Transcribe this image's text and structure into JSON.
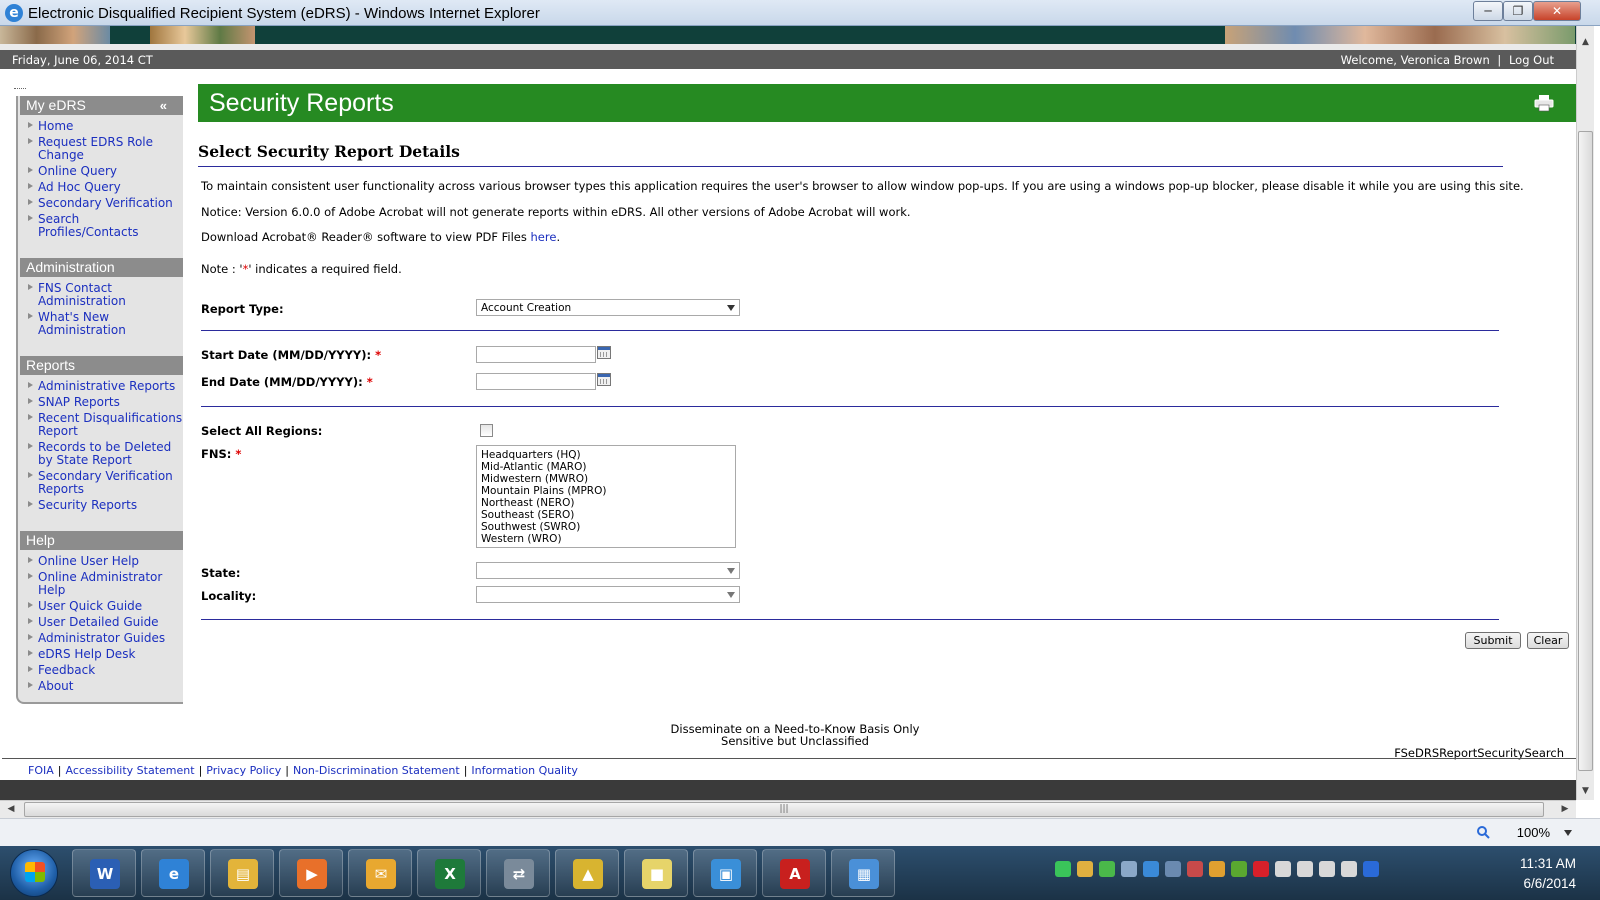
{
  "window": {
    "title": "Electronic Disqualified Recipient System (eDRS) - Windows Internet Explorer",
    "min_label": "─",
    "max_label": "❐",
    "close_label": "✕"
  },
  "status_bar": {
    "date": "Friday, June 06, 2014 CT",
    "welcome": "Welcome, Veronica Brown",
    "separator": "|",
    "logout": "Log Out"
  },
  "sidebar": {
    "collapse": "«",
    "sections": [
      {
        "title": "My eDRS",
        "items": [
          "Home",
          "Request EDRS Role Change",
          "Online Query",
          "Ad Hoc Query",
          "Secondary Verification",
          "Search Profiles/Contacts"
        ]
      },
      {
        "title": "Administration",
        "items": [
          "FNS Contact Administration",
          "What's New Administration"
        ]
      },
      {
        "title": "Reports",
        "items": [
          "Administrative Reports",
          "SNAP Reports",
          "Recent Disqualifications Report",
          "Records to be Deleted by State Report",
          "Secondary Verification Reports",
          "Security Reports"
        ]
      },
      {
        "title": "Help",
        "items": [
          "Online User Help",
          "Online Administrator Help",
          "User Quick Guide",
          "User Detailed Guide",
          "Administrator Guides",
          "eDRS Help Desk",
          "Feedback",
          "About"
        ]
      }
    ]
  },
  "header": {
    "page_title": "Security Reports",
    "print_icon": "printer-icon"
  },
  "main": {
    "section_title": "Select Security Report Details",
    "popup_notice": "To maintain consistent user functionality across various browser types this application requires the user's browser to allow window pop-ups. If you are using a windows pop-up blocker, please disable it while you are using this site.",
    "acrobat_notice": "Notice: Version 6.0.0 of Adobe Acrobat will not generate reports within eDRS. All other versions of Adobe Acrobat will work.",
    "download_text": "Download Acrobat® Reader® software to view PDF Files ",
    "download_link": "here",
    "download_end": ".",
    "note_prefix": "Note : '",
    "note_star": "*",
    "note_suffix": "' indicates a required field.",
    "required_mark": "*",
    "report_type_label": "Report Type:",
    "report_type_value": "Account Creation",
    "start_date_label": "Start Date (MM/DD/YYYY):",
    "end_date_label": "End Date (MM/DD/YYYY):",
    "select_all_label": "Select All Regions:",
    "fns_label": "FNS:",
    "fns_options": [
      "Headquarters (HQ)",
      "Mid-Atlantic (MARO)",
      "Midwestern (MWRO)",
      "Mountain Plains (MPRO)",
      "Northeast (NERO)",
      "Southeast (SERO)",
      "Southwest (SWRO)",
      "Western (WRO)"
    ],
    "state_label": "State:",
    "locality_label": "Locality:",
    "submit": "Submit",
    "clear": "Clear",
    "disseminate": "Disseminate on a Need-to-Know Basis Only",
    "sensitive": "Sensitive but Unclassified",
    "page_id": "FSeDRSReportSecuritySearch"
  },
  "footer": {
    "links": [
      "FOIA",
      "Accessibility Statement",
      "Privacy Policy",
      "Non-Discrimination Statement",
      "Information Quality"
    ],
    "sep": "|"
  },
  "ie": {
    "zoom": "100%",
    "zoom_icon": "zoom-icon",
    "scroll_up": "▲",
    "scroll_down": "▼",
    "scroll_left": "◀",
    "scroll_right": "▶",
    "grip": "|||"
  },
  "taskbar": {
    "apps": [
      {
        "icon": "word-icon",
        "letter": "W",
        "color": "#2b5fb4"
      },
      {
        "icon": "ie-icon",
        "letter": "e",
        "color": "#2f82d6"
      },
      {
        "icon": "explorer-folder-icon",
        "letter": "▤",
        "color": "#e3b43a"
      },
      {
        "icon": "media-player-icon",
        "letter": "▶",
        "color": "#e8702a"
      },
      {
        "icon": "outlook-icon",
        "letter": "✉",
        "color": "#e8a830"
      },
      {
        "icon": "excel-icon",
        "letter": "X",
        "color": "#1e7a3a"
      },
      {
        "icon": "network-icon",
        "letter": "⇄",
        "color": "#7a8a9a"
      },
      {
        "icon": "vpn-icon",
        "letter": "▲",
        "color": "#d8b430"
      },
      {
        "icon": "sticky-notes-icon",
        "letter": "■",
        "color": "#e6d46a"
      },
      {
        "icon": "remote-desktop-icon",
        "letter": "▣",
        "color": "#3a8fd8"
      },
      {
        "icon": "acrobat-icon",
        "letter": "A",
        "color": "#c8201e"
      },
      {
        "icon": "control-panel-icon",
        "letter": "▦",
        "color": "#4a90d8"
      }
    ],
    "tray_icons": [
      {
        "icon": "sync-icon",
        "color": "#3ac45a"
      },
      {
        "icon": "lock-icon",
        "color": "#e0b040"
      },
      {
        "icon": "plus-icon",
        "color": "#4ab84a"
      },
      {
        "icon": "display-icon",
        "color": "#8aa8c8"
      },
      {
        "icon": "shield-icon",
        "color": "#3a8ad8"
      },
      {
        "icon": "monitor-icon",
        "color": "#6a8ab0"
      },
      {
        "icon": "tools-icon",
        "color": "#c84a4a"
      },
      {
        "icon": "outlook-tray-icon",
        "color": "#e0a030"
      },
      {
        "icon": "nvidia-icon",
        "color": "#5aa830"
      },
      {
        "icon": "antivirus-icon",
        "color": "#d8202a"
      },
      {
        "icon": "flag-icon",
        "color": "#d8d8d8"
      },
      {
        "icon": "power-icon",
        "color": "#d8d8d8"
      },
      {
        "icon": "signal-icon",
        "color": "#d8d8d8"
      },
      {
        "icon": "volume-icon",
        "color": "#d8d8d8"
      },
      {
        "icon": "bluetooth-icon",
        "color": "#2a6ad8"
      }
    ],
    "time": "11:31 AM",
    "date": "6/6/2014"
  }
}
